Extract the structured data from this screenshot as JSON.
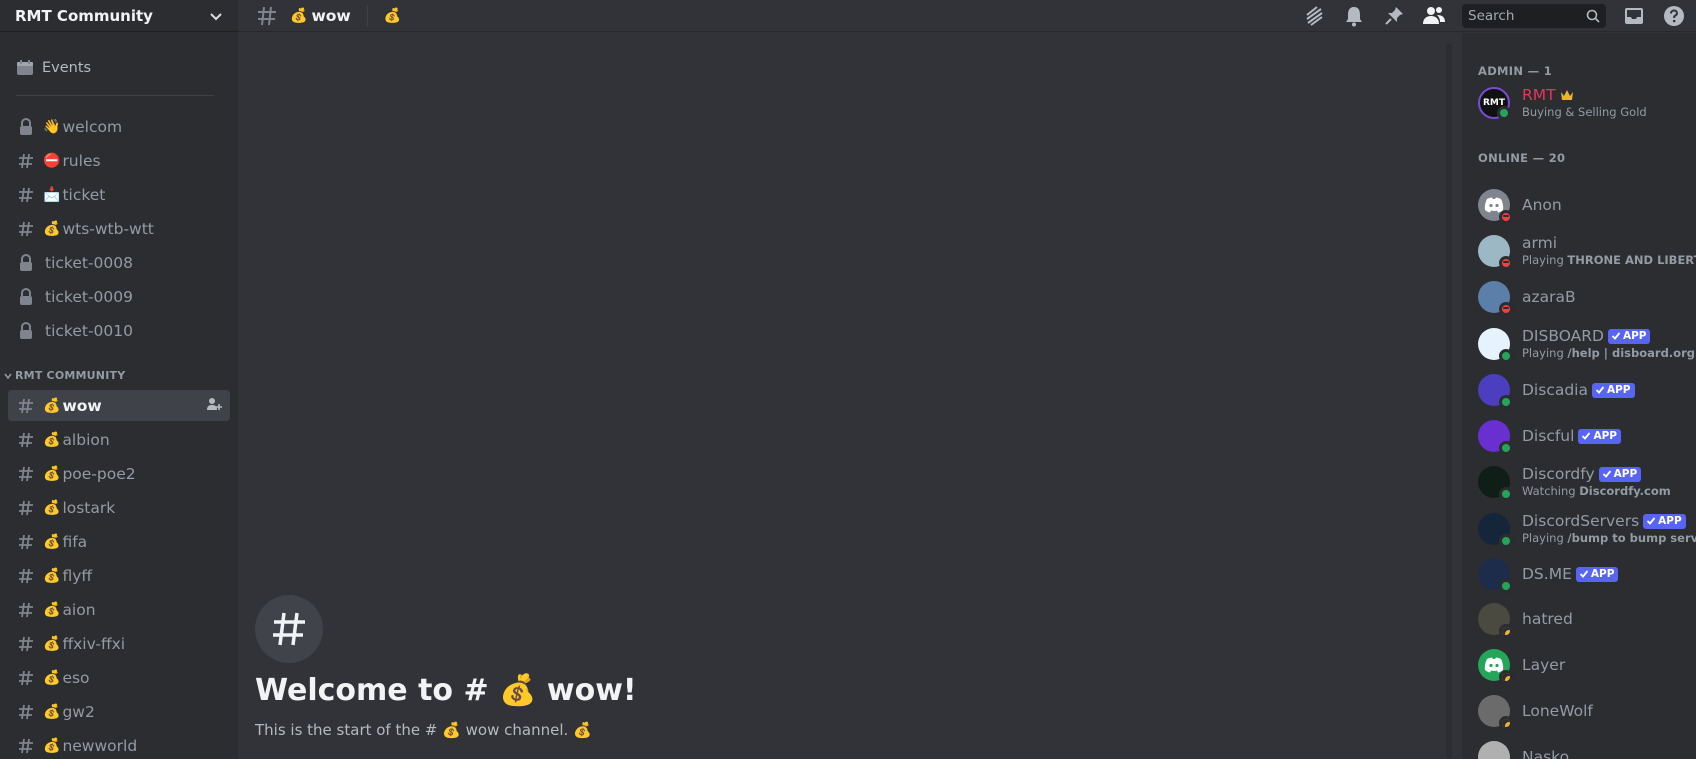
{
  "server": {
    "name": "RMT Community"
  },
  "sidebar": {
    "events_label": "Events",
    "top_channels": [
      {
        "icon": "lock-icon",
        "emoji": "👋",
        "name": "welcom"
      },
      {
        "icon": "hash-icon",
        "emoji": "⛔",
        "name": "rules"
      },
      {
        "icon": "hash-icon",
        "emoji": "📩",
        "name": "ticket"
      },
      {
        "icon": "hash-icon",
        "emoji": "💰",
        "name": "wts-wtb-wtt"
      },
      {
        "icon": "lock-icon",
        "emoji": "",
        "name": "ticket-0008"
      },
      {
        "icon": "lock-icon",
        "emoji": "",
        "name": "ticket-0009"
      },
      {
        "icon": "lock-icon",
        "emoji": "",
        "name": "ticket-0010"
      }
    ],
    "category": "RMT COMMUNITY",
    "category_channels": [
      {
        "emoji": "💰",
        "name": "wow",
        "active": true
      },
      {
        "emoji": "💰",
        "name": "albion"
      },
      {
        "emoji": "💰",
        "name": "poe-poe2"
      },
      {
        "emoji": "💰",
        "name": "lostark"
      },
      {
        "emoji": "💰",
        "name": "fifa"
      },
      {
        "emoji": "💰",
        "name": "flyff"
      },
      {
        "emoji": "💰",
        "name": "aion"
      },
      {
        "emoji": "💰",
        "name": "ffxiv-ffxi"
      },
      {
        "emoji": "💰",
        "name": "eso"
      },
      {
        "emoji": "💰",
        "name": "gw2"
      },
      {
        "emoji": "💰",
        "name": "newworld"
      }
    ]
  },
  "topbar": {
    "channel_emoji": "💰",
    "channel_name": "wow",
    "topic": "💰",
    "search_placeholder": "Search"
  },
  "chat": {
    "welcome_title": "Welcome to # 💰 wow!",
    "welcome_sub": "This is the start of the # 💰 wow channel.  💰"
  },
  "members": {
    "admin_header": "ADMIN — 1",
    "online_header": "ONLINE — 20",
    "admin": {
      "name": "RMT",
      "activity": "Buying & Selling Gold",
      "color": "#e3365a"
    },
    "list": [
      {
        "name": "Anon",
        "status": "dnd",
        "avatar": "#80848e",
        "avatar_icon": "discord-logo-icon"
      },
      {
        "name": "armi",
        "status": "dnd",
        "avatar": "#9bb8c4",
        "activity_prefix": "Playing ",
        "activity_bold": "THRONE AND LIBERTY"
      },
      {
        "name": "azaraB",
        "status": "dnd",
        "avatar": "#5b7fa8"
      },
      {
        "name": "DISBOARD",
        "status": "online",
        "avatar": "#e6f3ff",
        "app": "APP",
        "activity_prefix": "Playing ",
        "activity_bold": "/help | disboard.org"
      },
      {
        "name": "Discadia",
        "status": "online",
        "avatar": "#4b3fc0",
        "app": "APP"
      },
      {
        "name": "Discful",
        "status": "online",
        "avatar": "#6a2fd1",
        "app": "APP"
      },
      {
        "name": "Discordfy",
        "status": "online",
        "avatar": "#0f1e16",
        "app": "APP",
        "activity_prefix": "Watching ",
        "activity_bold": "Discordfy.com"
      },
      {
        "name": "DiscordServers",
        "status": "online",
        "avatar": "#16263a",
        "app": "APP",
        "activity_prefix": "Playing ",
        "activity_bold": "/bump to bump server"
      },
      {
        "name": "DS.ME",
        "status": "online",
        "avatar": "#1d2c4a",
        "app": "APP"
      },
      {
        "name": "hatred",
        "status": "idle",
        "avatar": "#4a4a40"
      },
      {
        "name": "Layer",
        "status": "idle",
        "avatar": "#23a55a",
        "avatar_icon": "discord-logo-icon"
      },
      {
        "name": "LoneWolf",
        "status": "idle",
        "avatar": "#6b6b6b"
      },
      {
        "name": "Nasko",
        "status": "idle",
        "avatar": "#b0b0b0"
      }
    ]
  }
}
